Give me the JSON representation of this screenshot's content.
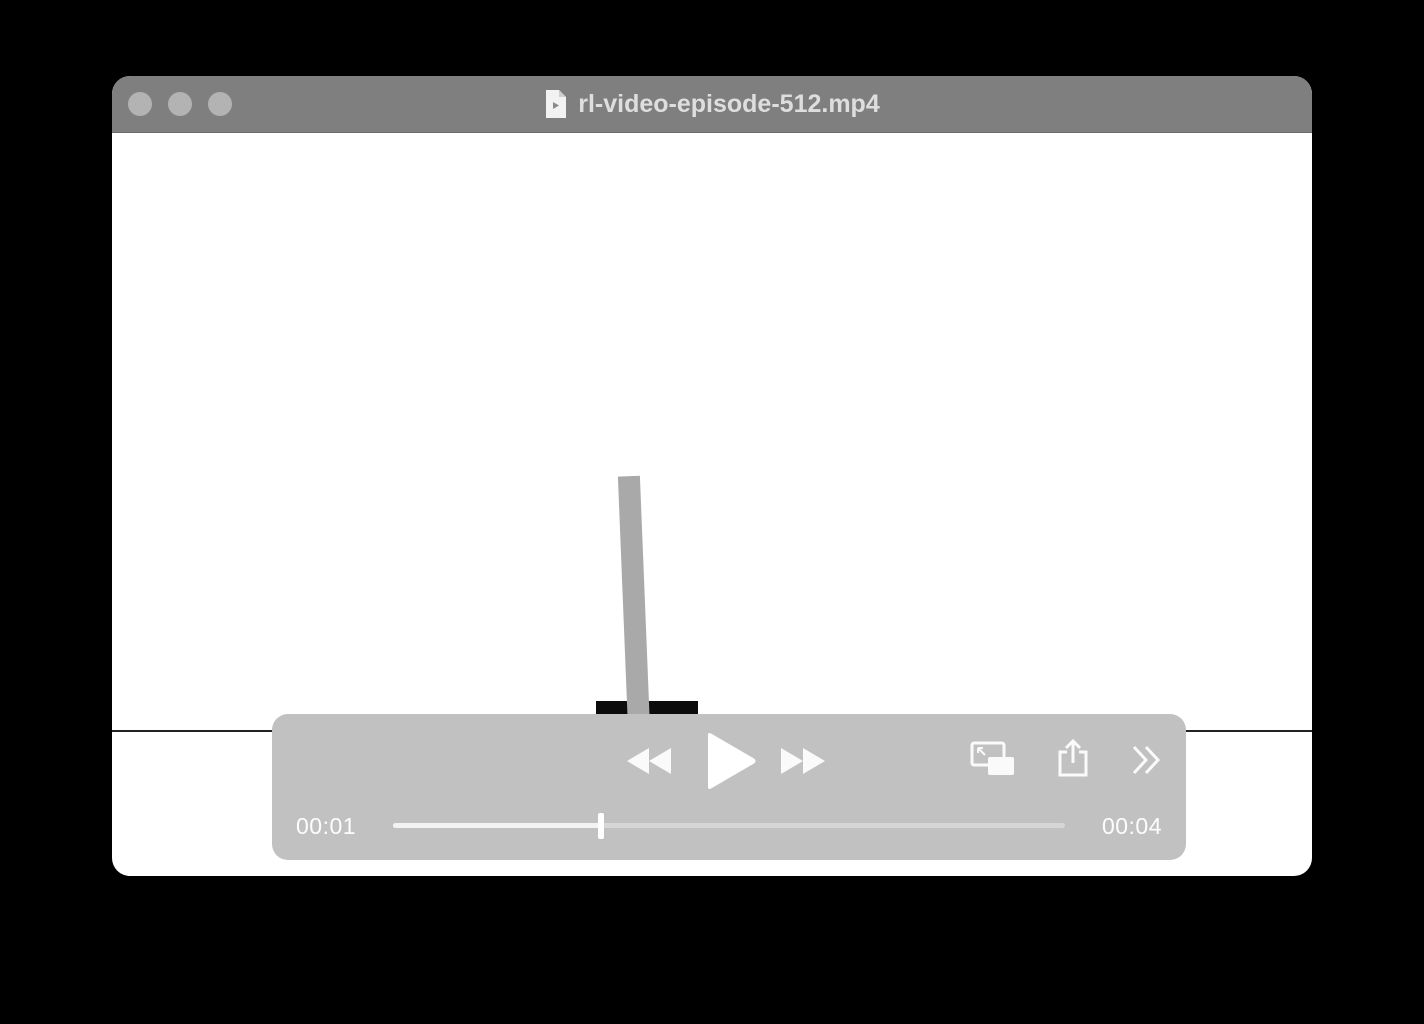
{
  "window": {
    "title": "rl-video-episode-512.mp4",
    "traffic_lights": [
      "close-button",
      "minimize-button",
      "zoom-button"
    ]
  },
  "player": {
    "current_time": "00:01",
    "total_time": "00:04",
    "progress": 0.31,
    "icons": [
      "rewind-icon",
      "play-icon",
      "fast-forward-icon",
      "picture-in-picture-icon",
      "share-icon",
      "more-icon"
    ]
  },
  "colors": {
    "titlebar": "#7f7f7f",
    "controls_panel": "#c1c1c1",
    "cart": "#0b0b0b",
    "pole": "#a9a9a9"
  }
}
